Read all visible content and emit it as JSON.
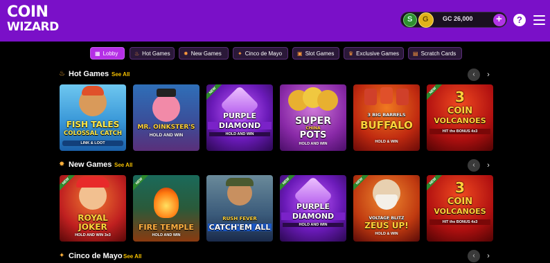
{
  "brand": {
    "logo_line1": "COIN",
    "logo_line2": "WIZARD"
  },
  "wallet": {
    "gc_label": "GC 26,000",
    "sc_icon": "sweeps-coin-icon",
    "gc_icon": "gold-coin-icon"
  },
  "header_icons": {
    "help": "?",
    "menu": "hamburger-menu-icon"
  },
  "tabs": [
    {
      "label": "Lobby",
      "icon": "lobby-icon",
      "active": true
    },
    {
      "label": "Hot Games",
      "icon": "flame-icon"
    },
    {
      "label": "New Games",
      "icon": "star-burst-icon"
    },
    {
      "label": "Cinco de Mayo",
      "icon": "party-hat-icon"
    },
    {
      "label": "Slot Games",
      "icon": "slot-icon"
    },
    {
      "label": "Exclusive Games",
      "icon": "crown-icon"
    },
    {
      "label": "Scratch Cards",
      "icon": "ticket-icon"
    }
  ],
  "sections": [
    {
      "title": "Hot Games",
      "see_all": "See All",
      "icon": "flame-icon",
      "games": [
        {
          "title_lines": [
            "FISH TALES",
            "COLOSSAL CATCH"
          ],
          "sub": "LINK & LOOT",
          "new": false
        },
        {
          "title_lines": [
            "MR. OINKSTER'S"
          ],
          "sub": "HOLD AND WIN",
          "new": false
        },
        {
          "title_lines": [
            "PURPLE",
            "DIAMOND"
          ],
          "sub": "HOLD AND WIN",
          "new": true,
          "badge": "NEW"
        },
        {
          "title_lines": [
            "SUPER",
            "CHINA",
            "POTS"
          ],
          "sub": "HOLD AND WIN",
          "new": false
        },
        {
          "title_lines": [
            "3 BIG BARRELS",
            "BUFFALO"
          ],
          "sub": "HOLD & WIN",
          "new": false
        },
        {
          "title_lines": [
            "3",
            "COIN",
            "VOLCANOES"
          ],
          "sub": "HIT the BONUS 4x3",
          "new": true,
          "badge": "NEW"
        }
      ]
    },
    {
      "title": "New Games",
      "see_all": "See All",
      "icon": "star-burst-icon",
      "games": [
        {
          "title_lines": [
            "ROYAL",
            "JOKER"
          ],
          "sub": "HOLD AND WIN 3x3",
          "new": true,
          "badge": "NEW"
        },
        {
          "title_lines": [
            "FIRE TEMPLE"
          ],
          "sub": "HOLD AND WIN",
          "new": true,
          "badge": "NEW"
        },
        {
          "title_lines": [
            "RUSH FEVER",
            "CATCH'EM ALL"
          ],
          "sub": "",
          "new": false
        },
        {
          "title_lines": [
            "PURPLE",
            "DIAMOND"
          ],
          "sub": "HOLD AND WIN",
          "new": true,
          "badge": "NEW"
        },
        {
          "title_lines": [
            "VOLTAGE BLITZ",
            "ZEUS UP!"
          ],
          "sub": "HOLD & WIN",
          "new": true,
          "badge": "NEW"
        },
        {
          "title_lines": [
            "3",
            "COIN",
            "VOLCANOES"
          ],
          "sub": "HIT the BONUS 4x3",
          "new": true,
          "badge": "NEW"
        }
      ]
    },
    {
      "title": "Cinco de Mayo",
      "see_all": "See All",
      "icon": "party-hat-icon",
      "games": []
    }
  ],
  "colors": {
    "header_bg": "#7a10c8",
    "active_tab": "#b52fe6",
    "see_all": "#f5c000",
    "page_bg": "#000000"
  }
}
